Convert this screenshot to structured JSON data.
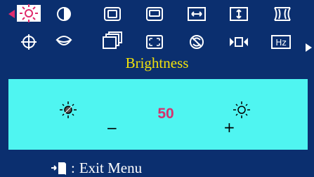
{
  "colors": {
    "menu_bg": "#0b2f6f",
    "title": "#f2e20b",
    "adjust_bg": "#4ff5f1",
    "value": "#d6316e",
    "selected_bg": "#ffffff",
    "selected_arrow": "#e02a6c"
  },
  "menu": {
    "selected_icon": "brightness-icon",
    "top_row": [
      "brightness-icon",
      "contrast-icon",
      "horizontal-position-icon",
      "vertical-position-icon",
      "horizontal-size-icon",
      "vertical-size-icon",
      "pincushion-icon"
    ],
    "bottom_row": [
      "geometry-icon",
      "pinbalance-icon",
      "trapezoid-icon",
      "rotation-icon",
      "degauss-icon",
      "moire-icon",
      "frequency-icon"
    ]
  },
  "title": "Brightness",
  "control": {
    "value": "50",
    "minus_label": "−",
    "plus_label": "+",
    "left_icon": "brightness-decrease-icon",
    "right_icon": "brightness-increase-icon"
  },
  "footer": {
    "colon": ":",
    "text": "Exit Menu",
    "icon": "exit-door-icon"
  }
}
